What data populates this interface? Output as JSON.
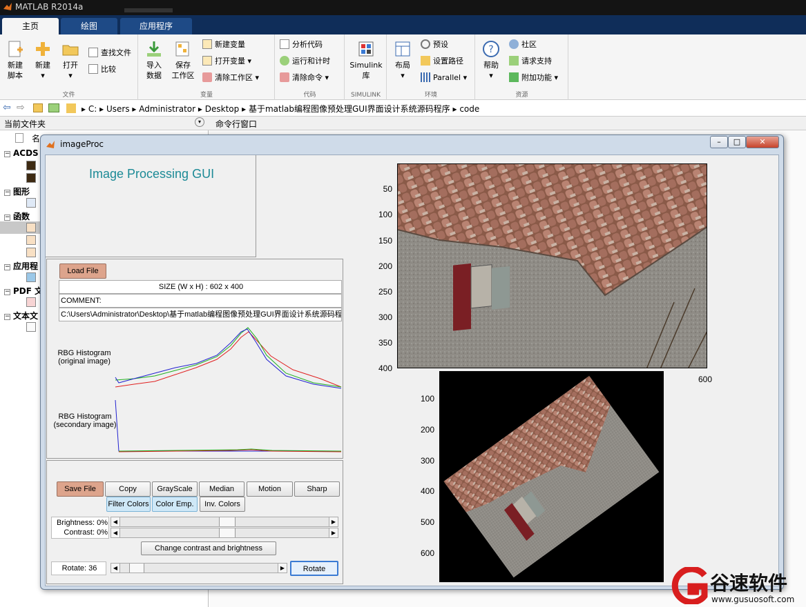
{
  "app": {
    "title": "MATLAB R2014a"
  },
  "ribbon_tabs": [
    "主页",
    "绘图",
    "应用程序"
  ],
  "ribbon": {
    "file": {
      "new_script": "新建\n脚本",
      "new": "新建",
      "open": "打开",
      "find_files": "查找文件",
      "compare": "比较",
      "group": "文件"
    },
    "variable": {
      "import": "导入\n数据",
      "save_ws": "保存\n工作区",
      "new_var": "新建变量",
      "open_var": "打开变量",
      "clear_ws": "清除工作区",
      "group": "变量"
    },
    "code": {
      "analyze": "分析代码",
      "run_time": "运行和计时",
      "clear_cmd": "清除命令",
      "group": "代码"
    },
    "simulink": {
      "lib": "Simulink\n库",
      "group": "SIMULINK"
    },
    "env": {
      "layout": "布局",
      "prefs": "预设",
      "set_path": "设置路径",
      "parallel": "Parallel",
      "group": "环境"
    },
    "resources": {
      "help": "帮助",
      "community": "社区",
      "support": "请求支持",
      "addons": "附加功能",
      "group": "资源"
    }
  },
  "address": [
    "C:",
    "Users",
    "Administrator",
    "Desktop",
    "基于matlab编程图像预处理GUI界面设计系统源码程序",
    "code"
  ],
  "panels": {
    "current_folder": "当前文件夹",
    "command_window": "命令行窗口",
    "name_col": "名"
  },
  "tree": [
    "ACDS",
    "图形",
    "函数",
    "应用程",
    "PDF 文",
    "文本文"
  ],
  "window": {
    "title": "imageProc"
  },
  "gui": {
    "heading": "Image Processing GUI",
    "load_file": "Load File",
    "size": "SIZE (W x H) : 602 x 400",
    "comment": "COMMENT:",
    "path": "C:\\Users\\Administrator\\Desktop\\基于matlab编程图像预处理GUI界面设计系统源码程序",
    "hist1": "RBG Histogram\n(original image)",
    "hist2": "RBG Histogram\n(secondary image)",
    "save_file": "Save File",
    "buttons": [
      "Copy",
      "GrayScale",
      "Median",
      "Motion",
      "Sharp"
    ],
    "buttons2": [
      "Filter Colors",
      "Color Emp.",
      "Inv. Colors"
    ],
    "brightness": "Brightness:  0%",
    "contrast": "Contrast:  0%",
    "change": "Change contrast and brightness",
    "rotate_label": "Rotate:  36",
    "rotate": "Rotate",
    "rotate_value": 36,
    "brightness_level": 0,
    "contrast_level": 0
  },
  "axes1": {
    "yticks": [
      "50",
      "100",
      "150",
      "200",
      "250",
      "300",
      "350",
      "400"
    ],
    "xticks": [
      "600"
    ]
  },
  "axes2": {
    "yticks": [
      "100",
      "200",
      "300",
      "400",
      "500",
      "600"
    ]
  },
  "watermark": {
    "text": "谷速软件",
    "url": "www.gusuosoft.com"
  },
  "colors": {
    "accent_teal": "#1c8a96",
    "salmon": "#dda48c",
    "ribbon_blue": "#0f2d59"
  }
}
